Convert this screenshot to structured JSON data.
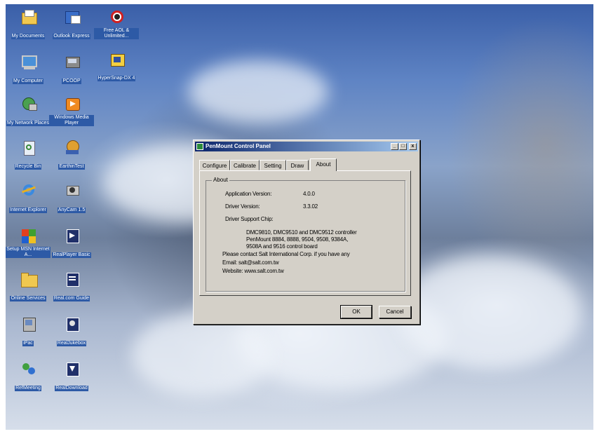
{
  "desktop": {
    "icons": [
      {
        "label": "My Documents",
        "icon": "folder-documents-icon"
      },
      {
        "label": "Outlook Express",
        "icon": "outlook-icon"
      },
      {
        "label": "Free AOL & Unlimited...",
        "icon": "aol-icon"
      },
      {
        "label": "My Computer",
        "icon": "computer-icon"
      },
      {
        "label": "PCOOP",
        "icon": "pcoop-icon"
      },
      {
        "label": "HyperSnap-DX 4",
        "icon": "hypersnap-icon"
      },
      {
        "label": "My Network Places",
        "icon": "network-icon"
      },
      {
        "label": "Windows Media Player",
        "icon": "media-player-icon"
      },
      {
        "label": "Recycle Bin",
        "icon": "recycle-bin-icon"
      },
      {
        "label": "EarthinTest",
        "icon": "earth-icon"
      },
      {
        "label": "Internet Explorer",
        "icon": "ie-icon"
      },
      {
        "label": "AnyCam 1.5",
        "icon": "camera-icon"
      },
      {
        "label": "Setup MSN Internet A...",
        "icon": "msn-icon"
      },
      {
        "label": "RealPlayer Basic",
        "icon": "realplayer-icon"
      },
      {
        "label": "Online Services",
        "icon": "folder-icon"
      },
      {
        "label": "Real.com Guide",
        "icon": "real-guide-icon"
      },
      {
        "label": "iPac",
        "icon": "ipac-icon"
      },
      {
        "label": "RealJukebox",
        "icon": "jukebox-icon"
      },
      {
        "label": "RefMeeting",
        "icon": "meeting-icon"
      },
      {
        "label": "RealDownload",
        "icon": "download-icon"
      }
    ]
  },
  "dialog": {
    "title": "PenMount Control Panel",
    "controls": {
      "minimize": "_",
      "maximize": "□",
      "close": "x"
    },
    "tabs": [
      {
        "label": "Configure"
      },
      {
        "label": "Calibrate"
      },
      {
        "label": "Setting"
      },
      {
        "label": "Draw"
      },
      {
        "label": "About"
      }
    ],
    "active_tab": "About",
    "about": {
      "group_label": "About",
      "app_version_label": "Application Version:",
      "app_version_value": "4.0.0",
      "driver_version_label": "Driver Version:",
      "driver_version_value": "3.3.02",
      "support_chip_label": "Driver Support Chip:",
      "support_chip_lines": [
        "DMC9810, DMC9510 and DMC9512 controller",
        "PenMount 8884, 8888, 9504, 9508, 9384A,",
        "9508A and 9516 control board"
      ],
      "contact": "Please contact Salt International Corp. if you have any",
      "email": "Email: salt@salt.com.tw",
      "website": "Website: www.salt.com.tw"
    },
    "buttons": {
      "ok": "OK",
      "cancel": "Cancel"
    }
  }
}
